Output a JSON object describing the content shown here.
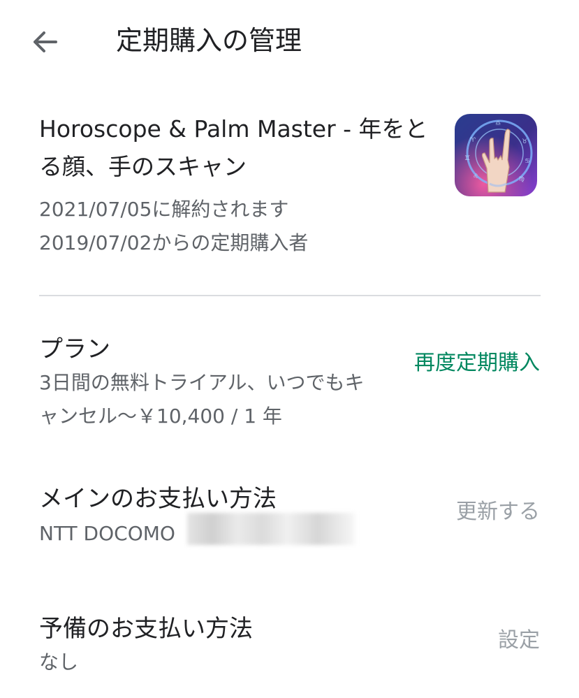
{
  "header": {
    "back_icon": "arrow-left-icon",
    "title": "定期購入の管理"
  },
  "app": {
    "name": "Horoscope & Palm Master - 年をとる顔、手のスキャン",
    "icon": "horoscope-app-icon",
    "cancel_note": "2021/07/05に解約されます",
    "subscriber_since": "2019/07/02からの定期購入者"
  },
  "plan": {
    "title": "プラン",
    "description": "3日間の無料トライアル、いつでもキャンセル〜￥10,400 / 1 年",
    "action_label": "再度定期購入"
  },
  "primary_payment": {
    "title": "メインのお支払い方法",
    "method": "NTT DOCOMO",
    "action_label": "更新する"
  },
  "backup_payment": {
    "title": "予備のお支払い方法",
    "method": "なし",
    "action_label": "設定"
  },
  "colors": {
    "accent_green": "#01875f",
    "text_primary": "#202124",
    "text_secondary": "#5f6368",
    "text_disabled": "#9aa0a6",
    "divider": "#dadce0"
  }
}
